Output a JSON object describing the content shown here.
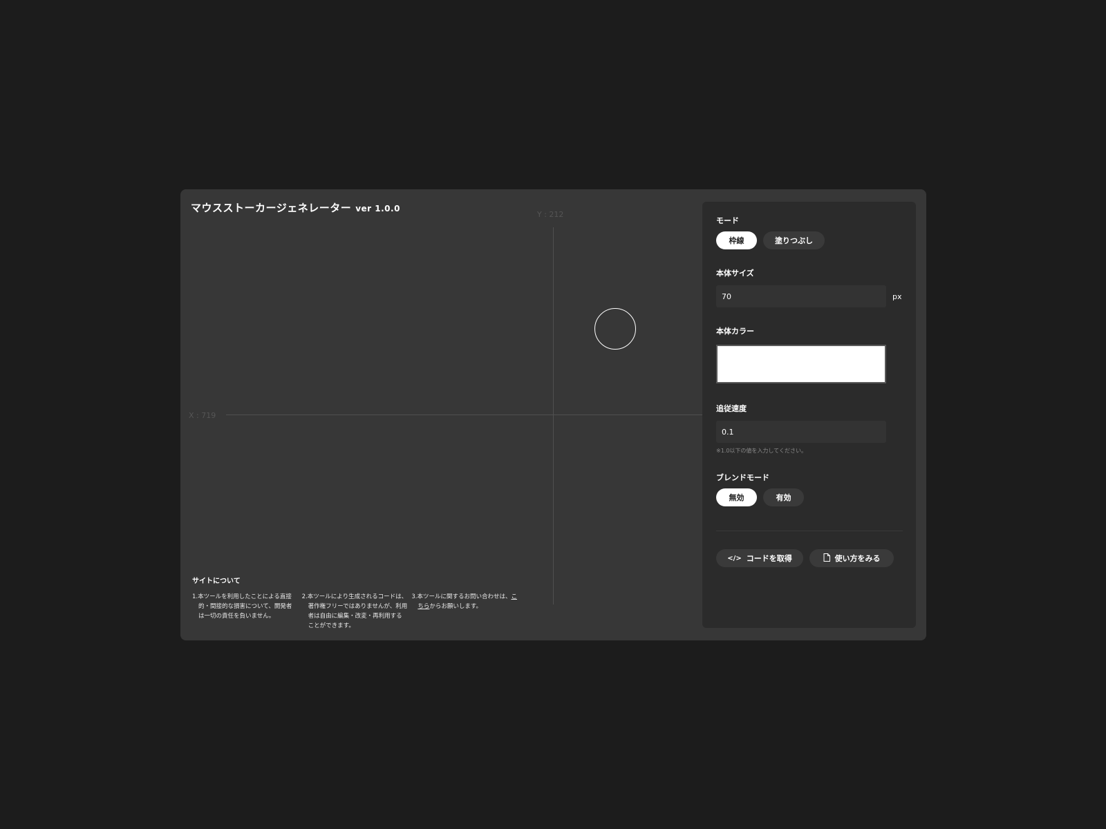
{
  "app": {
    "title": "マウスストーカージェネレーター",
    "version": "ver 1.0.0"
  },
  "canvas": {
    "y_readout": "Y : 212",
    "x_readout": "X : 719"
  },
  "about": {
    "title": "サイトについて",
    "note1": "1.本ツールを利用したことによる直接的・間接的な損害について、開発者は一切の責任を負いません。",
    "note2": "2.本ツールにより生成されるコードは、著作権フリーではありませんが、利用者は自由に編集・改変・再利用することができます。",
    "note3_prefix": "3.本ツールに関するお問い合わせは、",
    "note3_link": "こちら",
    "note3_suffix": "からお願いします。"
  },
  "settings": {
    "mode": {
      "label": "モード",
      "options": [
        "枠線",
        "塗りつぶし"
      ],
      "selected": "枠線"
    },
    "size": {
      "label": "本体サイズ",
      "value": "70",
      "unit": "px"
    },
    "color": {
      "label": "本体カラー",
      "value": "#ffffff"
    },
    "speed": {
      "label": "追従速度",
      "value": "0.1",
      "hint": "※1.0以下の値を入力してください。"
    },
    "blend": {
      "label": "ブレンドモード",
      "options": [
        "無効",
        "有効"
      ],
      "selected": "無効"
    },
    "actions": {
      "get_code": "コードを取得",
      "get_code_icon": "code-icon",
      "how_to": "使い方をみる",
      "how_to_icon": "document-icon"
    }
  }
}
